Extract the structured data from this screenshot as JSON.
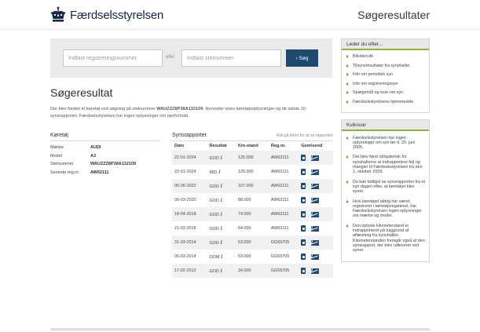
{
  "header": {
    "logo_text": "Færdselsstyrelsen",
    "page_heading": "Søgeresultater"
  },
  "search": {
    "reg_placeholder": "Indtast registreringsnummer",
    "or_label": "eller",
    "stel_placeholder": "Indtast stelnummer",
    "button_label": "› Søg"
  },
  "result": {
    "title": "Søgeresultat",
    "intro_prefix": "Der blev fundet ét køretøj ved søgning på stelnummer ",
    "vin_bold": "WAUZZZ8P38A132109",
    "intro_suffix": ". Herunder vises køretøjsoplysninger og de sidste 10 synsrapporter. Færdselsstyrelsen har ingen oplysninger om ejerforhold."
  },
  "car": {
    "title": "Køretøj",
    "rows": [
      {
        "label": "Mærke",
        "value": "AUDI"
      },
      {
        "label": "Model",
        "value": "A3"
      },
      {
        "label": "Stelnummer",
        "value": "WAUZZZ8P38A132109"
      },
      {
        "label": "Seneste reg.nr.",
        "value": "AW62111"
      }
    ]
  },
  "reports": {
    "title": "Synsrapporter",
    "click_hint": "Klik på feltet for at se rapporten",
    "columns": [
      "Dato",
      "Resultat",
      "Km-stand",
      "Reg.nr.",
      "Gem/send"
    ],
    "rows": [
      {
        "date": "22-01-2024",
        "result": "GOD",
        "km": "125.000",
        "reg": "AW62111"
      },
      {
        "date": "22-01-2024",
        "result": "MID",
        "km": "125.000",
        "reg": "AW62111"
      },
      {
        "date": "05-05-2022",
        "result": "GOD",
        "km": "107.000",
        "reg": "AW62111"
      },
      {
        "date": "09-03-2020",
        "result": "GOD",
        "km": "88.000",
        "reg": "AW62111"
      },
      {
        "date": "18-04-2018",
        "result": "GOD",
        "km": "74.000",
        "reg": "AW62111"
      },
      {
        "date": "21-03-2016",
        "result": "GOD",
        "km": "64.000",
        "reg": "AW62111"
      },
      {
        "date": "31-03-2014",
        "result": "GOD",
        "km": "53.000",
        "reg": "GG59705"
      },
      {
        "date": "05-03-2014",
        "result": "OOM",
        "km": "53.000",
        "reg": "GG59705"
      },
      {
        "date": "17-02-2012",
        "result": "GOD",
        "km": "34.000",
        "reg": "GG59705"
      }
    ]
  },
  "sidebar": {
    "leder_title": "Leder du efter...",
    "leder_items": [
      "Bilviden.dk",
      "Tilsynsresultater fra synshaller",
      "Info om periodisk syn",
      "Info om registreringssyn",
      "Spørgsmål og svar om syn",
      "Færdselsstyrelsens hjemmeside"
    ],
    "kviksvar_title": "Kviksvar",
    "kviksvar_items": [
      "Færdselsstyrelsen har ingen oplysninger om syn før d. 20. juni 2005.",
      "Det blev først obligatorisk for synshallerne at indrapportere fejl og mangler til Færdselsstyrelsen fra den 1. oktober 2009.",
      "Du kan bidligst se synsrapporten fra et syn dagen efter, at køretøjet blev synet.",
      "Hvis køretøjet aldrig har været registreret i køretøjsregisteret, har Færdselsstyrelsen ingen oplysninger om mærke og model.",
      "Den oplyste kilometerstand er indrapporteret på baggrund af aflæsning fra synshallen. Kilometerstanden fremgår også af den synsrapport, der blev udleveret ved synet."
    ]
  },
  "colors": {
    "brand_navy": "#13284a",
    "button_blue": "#20496f",
    "accent_green": "#8fb33e"
  }
}
